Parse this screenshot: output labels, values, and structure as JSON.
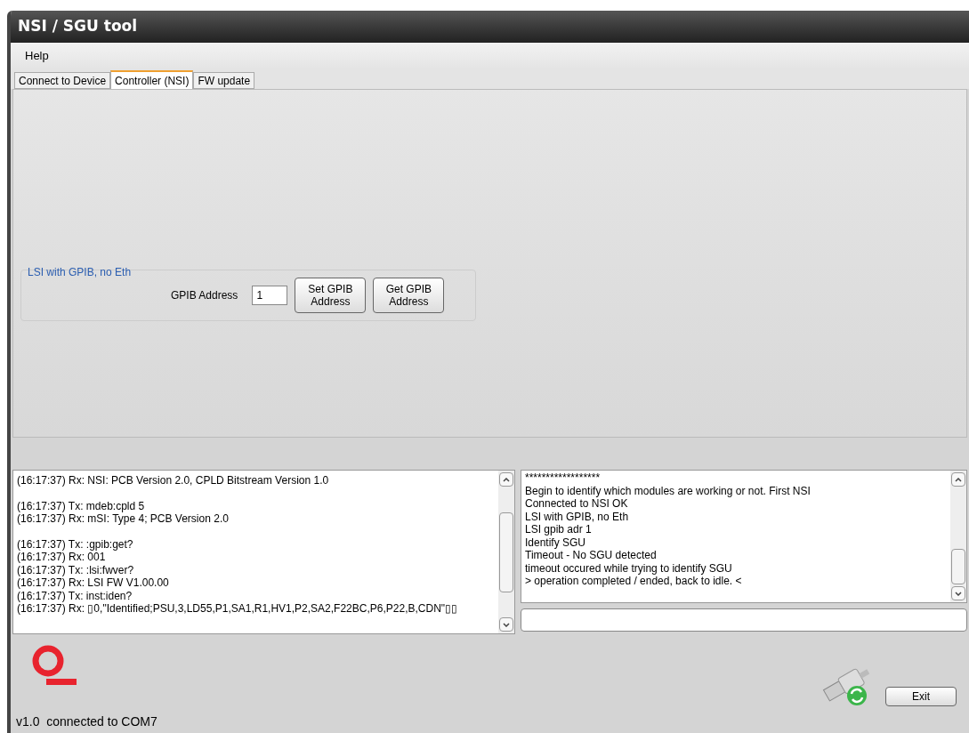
{
  "window": {
    "title": "NSI / SGU tool"
  },
  "menu": [
    "Help"
  ],
  "tabs": [
    {
      "label": "Connect to Device",
      "selected": false
    },
    {
      "label": "Controller (NSI)",
      "selected": true
    },
    {
      "label": "FW update",
      "selected": false
    }
  ],
  "group": {
    "title": "LSI with GPIB, no Eth",
    "field_label": "GPIB Address",
    "field_value": "1",
    "buttons": [
      "Set GPIB Address",
      "Get GPIB Address"
    ]
  },
  "left_log": {
    "blocks": [
      [
        "(16:17:37) Rx: NSI: PCB Version 2.0, CPLD Bitstream Version 1.0"
      ],
      [
        "(16:17:37) Tx: mdeb:cpld 5",
        "(16:17:37) Rx: mSI: Type 4; PCB Version 2.0"
      ],
      [
        "(16:17:37) Tx: :gpib:get?",
        "(16:17:37) Rx: 001",
        "(16:17:37) Tx: :lsi:fwver?",
        "(16:17:37) Rx: LSI FW V1.00.00",
        "(16:17:37) Tx: inst:iden?",
        "(16:17:37) Rx: ▯0,\"Identified;PSU,3,LD55,P1,SA1,R1,HV1,P2,SA2,F22BC,P6,P22,B,CDN\"▯▯"
      ]
    ]
  },
  "right_log": {
    "lines": [
      "******************",
      "Begin to identify which modules are working or not. First NSI",
      "Connected to NSI OK",
      "LSI with GPIB, no Eth",
      "LSI gpib adr 1",
      "Identify SGU",
      "Timeout - No SGU detected",
      "timeout occured while trying to identify SGU",
      "> operation completed / ended, back to idle. <"
    ]
  },
  "exit_button": "Exit",
  "status_bar": "v1.0  connected to COM7"
}
